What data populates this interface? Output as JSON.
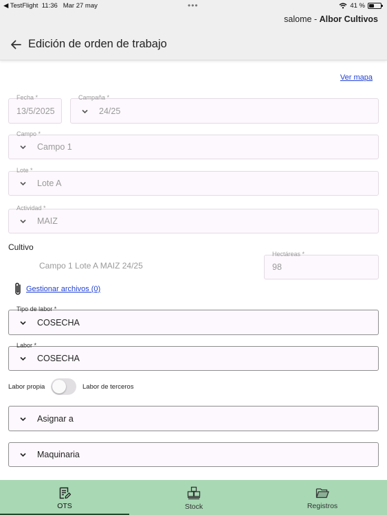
{
  "status_bar": {
    "back_app": "◀ TestFlight",
    "time": "11:36",
    "date": "Mar 27 may",
    "dots": "•••",
    "battery": "41 %"
  },
  "user": {
    "name": "salome",
    "separator": " - ",
    "company": "Albor Cultivos"
  },
  "header": {
    "title": "Edición de orden de trabajo"
  },
  "form": {
    "ver_mapa": "Ver mapa",
    "fecha": {
      "label": "Fecha *",
      "value": "13/5/2025"
    },
    "campana": {
      "label": "Campaña *",
      "value": "24/25"
    },
    "campo": {
      "label": "Campo *",
      "value": "Campo 1"
    },
    "lote": {
      "label": "Lote *",
      "value": "Lote A"
    },
    "actividad": {
      "label": "Actividad *",
      "value": "MAIZ"
    },
    "cultivo": {
      "label": "Cultivo",
      "value": "Campo 1 Lote A MAIZ 24/25"
    },
    "hectareas": {
      "label": "Hectáreas *",
      "value": "98"
    },
    "files_link": "Gestionar archivos (0)",
    "tipo_labor": {
      "label": "Tipo de labor *",
      "value": "COSECHA"
    },
    "labor": {
      "label": "Labor *",
      "value": "COSECHA"
    },
    "toggle": {
      "left": "Labor propia",
      "right": "Labor de terceros",
      "on": false
    },
    "asignar": {
      "placeholder": "Asignar a"
    },
    "maquinaria": {
      "placeholder": "Maquinaria"
    }
  },
  "bottom_nav": {
    "items": [
      {
        "label": "OTS",
        "icon": "document-edit-icon",
        "active": true
      },
      {
        "label": "Stock",
        "icon": "boxes-icon",
        "active": false
      },
      {
        "label": "Registros",
        "icon": "folder-open-icon",
        "active": false
      }
    ]
  },
  "colors": {
    "nav_bg": "#a8d8b4",
    "link": "#1f3fd6",
    "field_bg": "#fdf8fd",
    "header_bg": "#efefef"
  }
}
